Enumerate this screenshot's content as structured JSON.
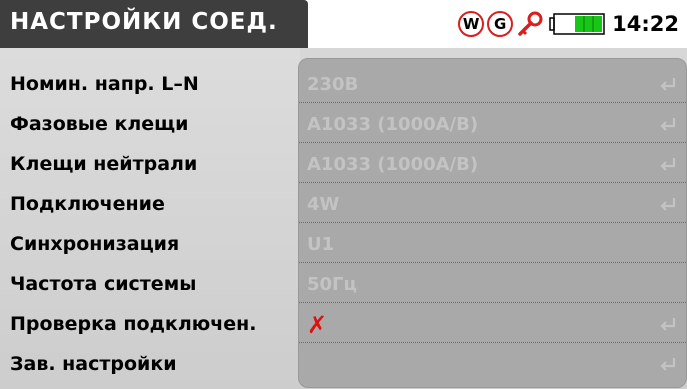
{
  "header": {
    "title": "НАСТРОЙКИ СОЕД.",
    "status_icons": [
      {
        "name": "w-indicator-icon",
        "text": "W"
      },
      {
        "name": "g-indicator-icon",
        "text": "G"
      }
    ],
    "clock": "14:22",
    "battery_level": 1.0
  },
  "colors": {
    "header_bg": "#3e3e3e",
    "panel_bg": "#a9a9a9",
    "accent_red": "#d81e1e",
    "battery_green": "#17c617"
  },
  "settings": [
    {
      "label": "Номин. напр. L–N",
      "value": "230В",
      "enter_icon": true
    },
    {
      "label": "Фазовые клещи",
      "value": "A1033 (1000A/B)",
      "enter_icon": true
    },
    {
      "label": "Клещи нейтрали",
      "value": "A1033 (1000A/B)",
      "enter_icon": true
    },
    {
      "label": "Подключение",
      "value": "4W",
      "enter_icon": true
    },
    {
      "label": "Синхронизация",
      "value": "U1",
      "enter_icon": false
    },
    {
      "label": "Частота системы",
      "value": "50Гц",
      "enter_icon": false
    },
    {
      "label": "Проверка подключен.",
      "value": "✗",
      "enter_icon": true
    },
    {
      "label": "Зав. настройки",
      "value": "",
      "enter_icon": true
    }
  ]
}
